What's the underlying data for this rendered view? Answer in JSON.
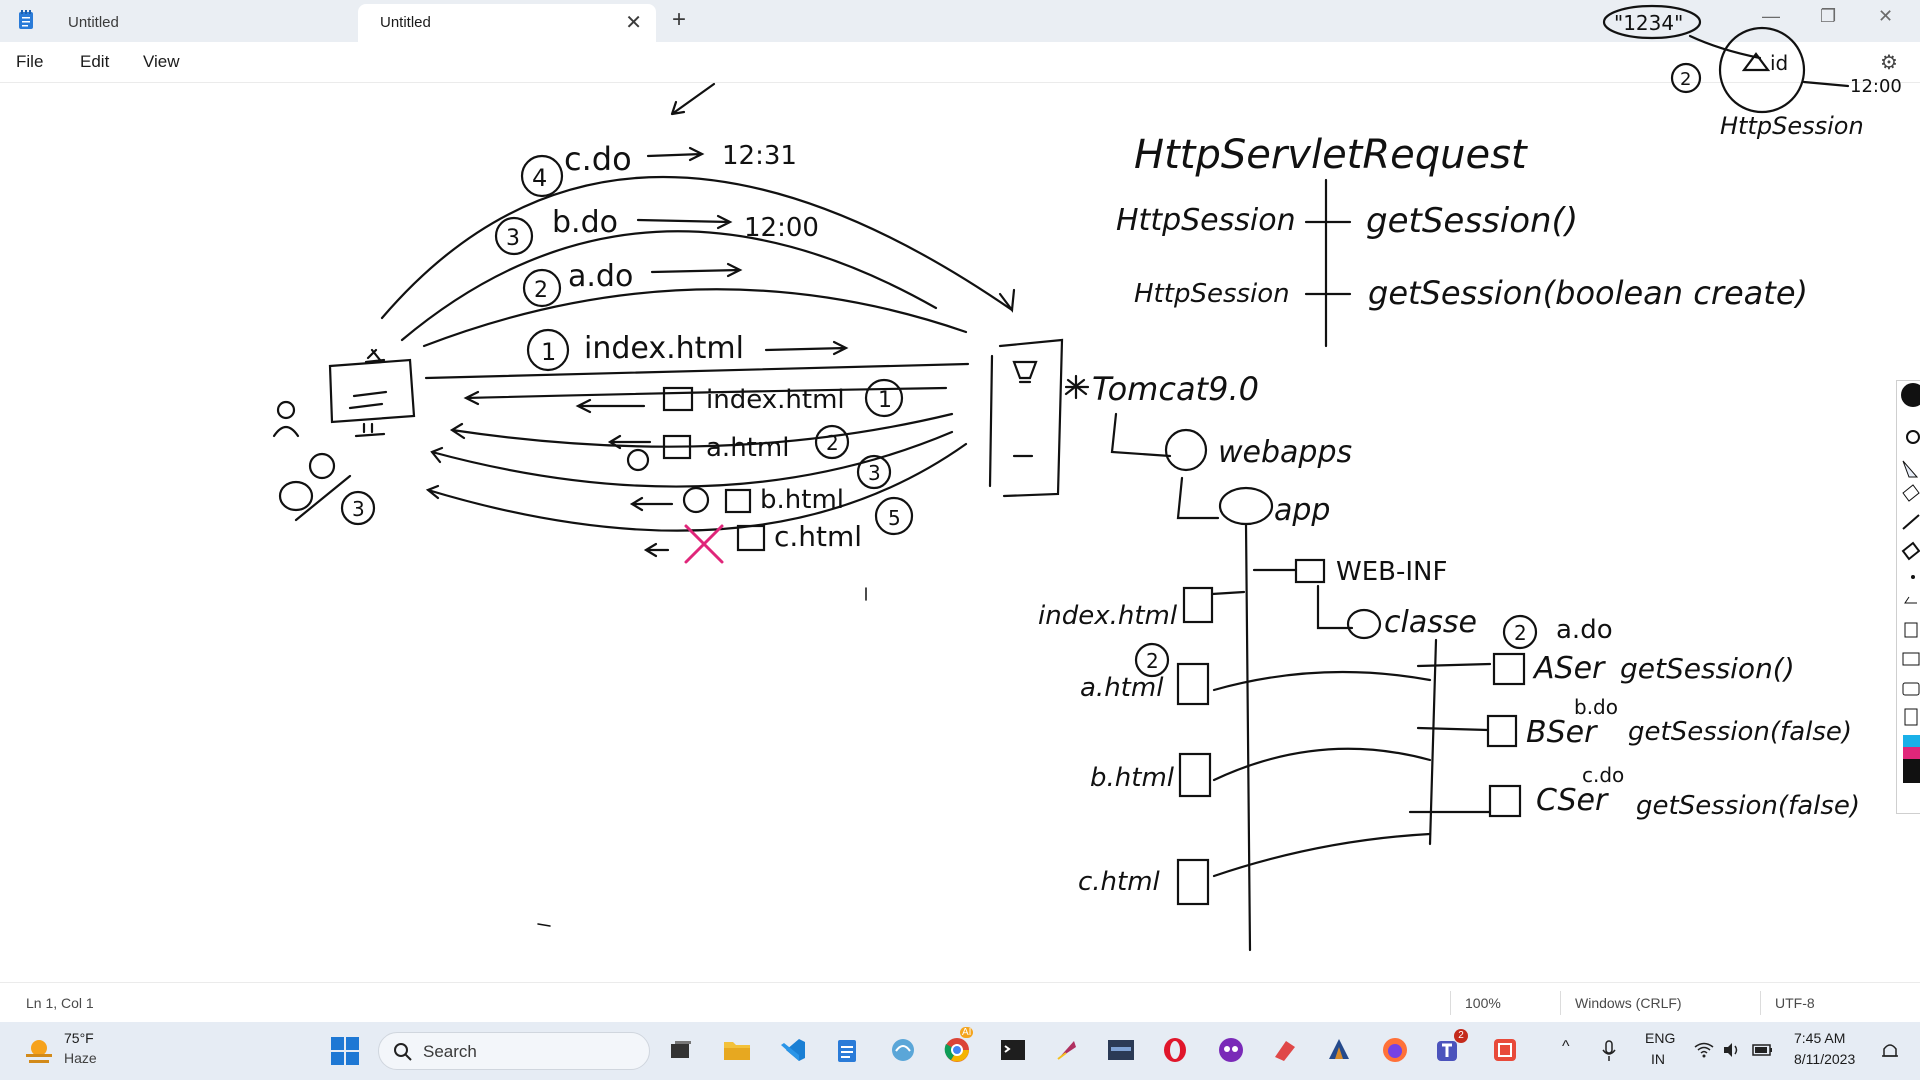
{
  "window": {
    "tabs": [
      {
        "label": "Untitled",
        "active": false
      },
      {
        "label": "Untitled",
        "active": true
      }
    ],
    "new_tab": "+",
    "close_tab": "✕",
    "controls": {
      "minimize": "—",
      "maximize": "❐",
      "close": "✕"
    }
  },
  "menu": {
    "file": "File",
    "edit": "Edit",
    "view": "View"
  },
  "ink": {
    "session_id": "\"1234\"",
    "id_label": "id",
    "top_time": "12:00",
    "httpsession_top": "HttpSession",
    "circle_2_top": "2",
    "request_title": "HttpServletRequest",
    "method_left_1": "HttpSession",
    "method_right_1": "getSession()",
    "method_left_2": "HttpSession",
    "method_right_2": "getSession(boolean create)",
    "req_c": "c.do",
    "req_c_num": "4",
    "req_c_time": "12:31",
    "req_b": "b.do",
    "req_b_num": "3",
    "req_b_time": "12:00",
    "req_a": "a.do",
    "req_a_num": "2",
    "req_index": "index.html",
    "req_index_num": "1",
    "resp_index": "index.html",
    "resp_index_num": "1",
    "resp_a": "a.html",
    "resp_a_num": "2",
    "resp_b": "b.html",
    "resp_b_num": "3",
    "resp_c": "c.html",
    "resp_c_num": "5",
    "client_circle": "3",
    "server": "Tomcat9.0",
    "webapps": "webapps",
    "app": "app",
    "webinf": "WEB-INF",
    "classes": "classe",
    "file_index": "index.html",
    "file_a": "a.html",
    "file_a_num": "2",
    "file_b": "b.html",
    "file_c": "c.html",
    "servlet_a_num": "2",
    "servlet_a_req": "a.do",
    "servlet_a": "ASer",
    "servlet_a_call": "getSession()",
    "servlet_b_req": "b.do",
    "servlet_b": "BSer",
    "servlet_b_call": "getSession(false)",
    "servlet_c_req": "c.do",
    "servlet_c": "CSer",
    "servlet_c_call": "getSession(false)"
  },
  "status": {
    "position": "Ln 1, Col 1",
    "zoom": "100%",
    "line_ending": "Windows (CRLF)",
    "encoding": "UTF-8"
  },
  "taskbar": {
    "temperature": "75°F",
    "condition": "Haze",
    "search_placeholder": "Search",
    "language": "ENG",
    "region": "IN",
    "time": "7:45 AM",
    "date": "8/11/2023",
    "badge_count": "2",
    "chrome_badge": "AI"
  }
}
